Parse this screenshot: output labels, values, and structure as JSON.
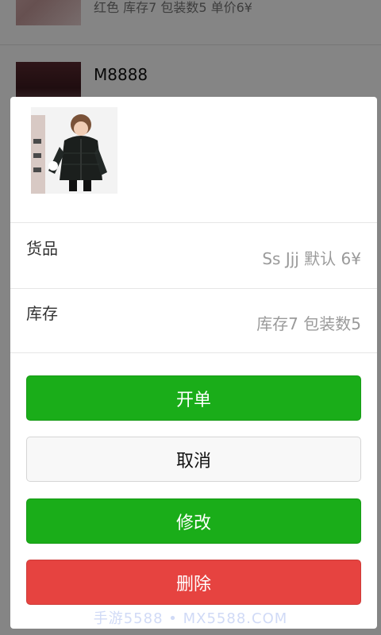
{
  "background_list": {
    "items": [
      {
        "subtitle": "红色 库存7 包装数5 单价6¥"
      },
      {
        "title": "M8888"
      }
    ]
  },
  "sheet": {
    "product_image": "child-in-black-down-jacket-photo",
    "rows": [
      {
        "label": "货品",
        "value": "Ss Jjj 默认 6¥"
      },
      {
        "label": "库存",
        "value": "库存7 包装数5"
      }
    ],
    "buttons": {
      "open_order": "开单",
      "cancel": "取消",
      "edit": "修改",
      "delete": "删除"
    }
  },
  "watermark": "手游5588 • MX5588.COM",
  "colors": {
    "primary_green": "#1aad19",
    "danger_red": "#e64340",
    "mask": "rgba(0,0,0,0.48)"
  }
}
